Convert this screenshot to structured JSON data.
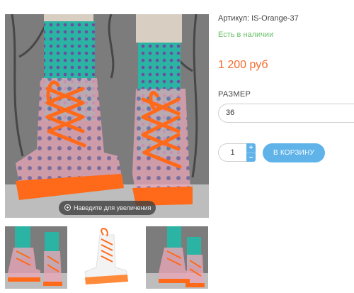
{
  "gallery": {
    "zoom_hint": "Наведите для увеличения",
    "thumbnails": [
      {
        "icon": "boots-on-feet-photo"
      },
      {
        "icon": "boot-product-photo"
      },
      {
        "icon": "boots-on-feet-photo"
      }
    ]
  },
  "product": {
    "sku": "Артикул: IS-Orange-37",
    "stock": "Есть в наличии",
    "price": "1 200 руб"
  },
  "options": {
    "size_label": "РАЗМЕР",
    "size_value": "36"
  },
  "purchase": {
    "quantity": "1",
    "plus": "+",
    "minus": "−",
    "cart_label": "В КОРЗИНУ"
  },
  "colors": {
    "accent": "#5fb3e8",
    "price": "#f26b2a",
    "stock": "#6cc06a",
    "sole": "#ff6a1a",
    "sock": "#2bb3a3"
  }
}
